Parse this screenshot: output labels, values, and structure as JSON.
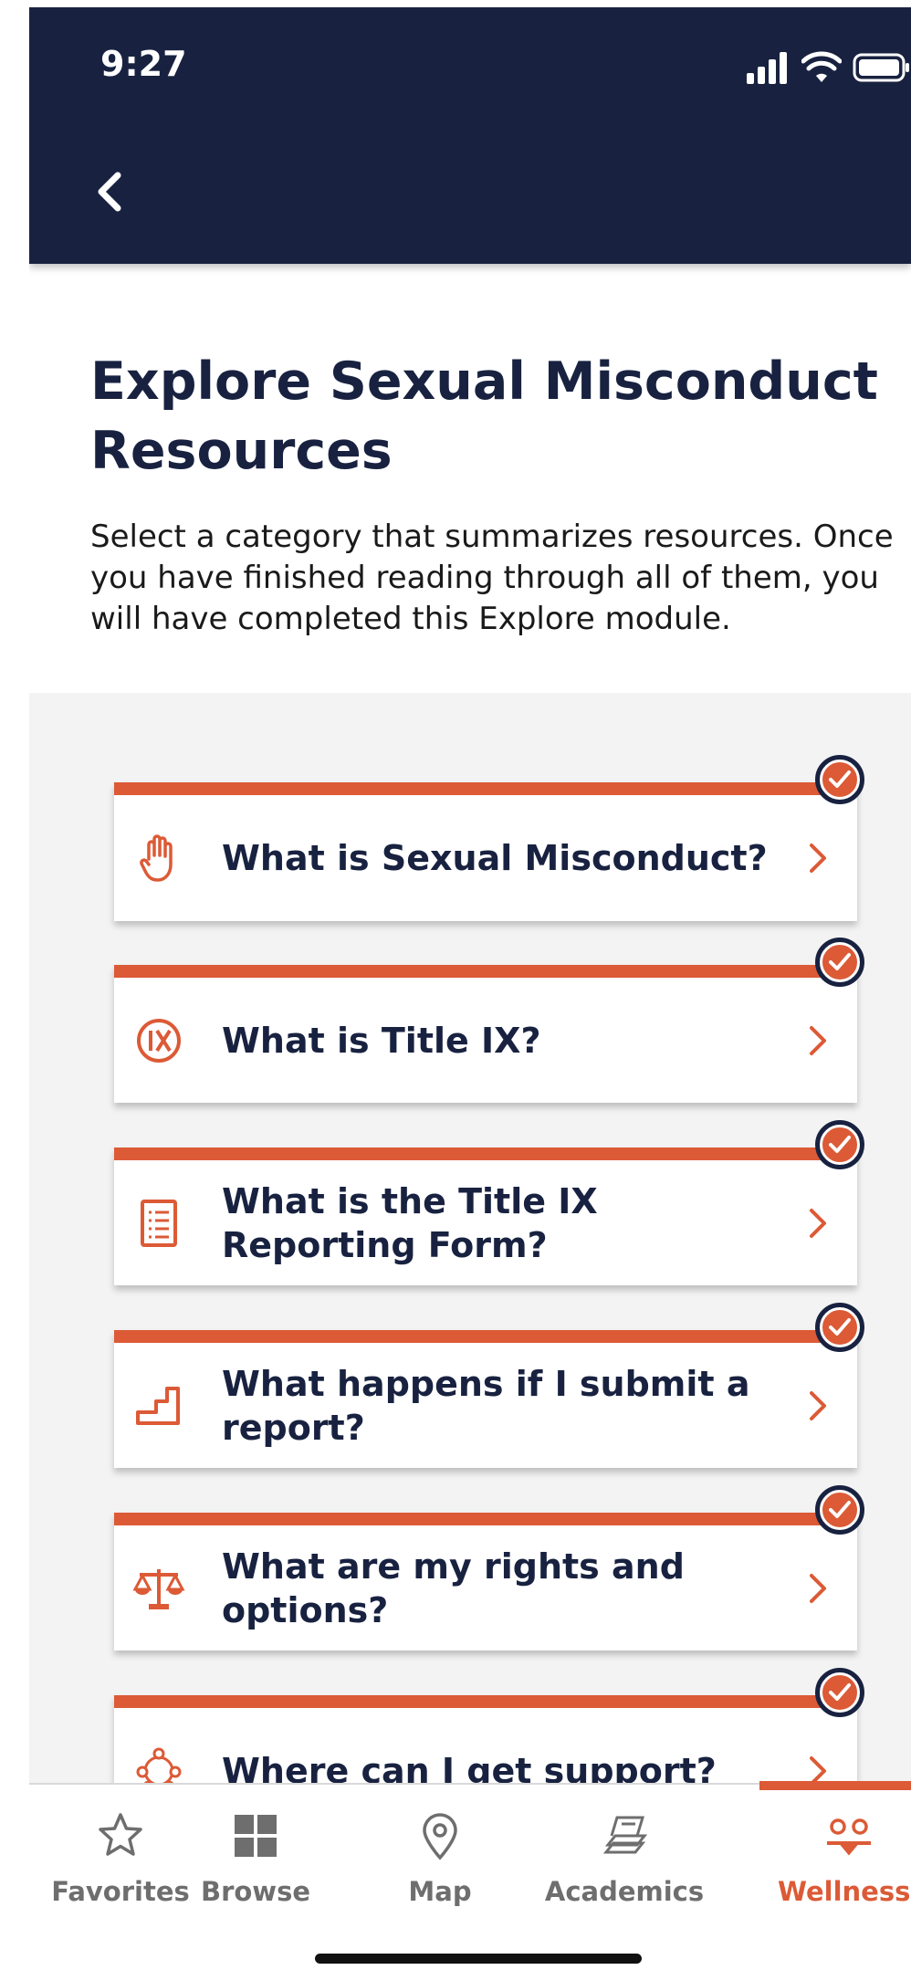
{
  "status": {
    "time": "9:27",
    "signal_icon": "signal-bars-icon",
    "wifi_icon": "wifi-icon",
    "battery_icon": "battery-icon"
  },
  "header": {
    "back_icon": "chevron-left-icon",
    "background_color": "#182240"
  },
  "intro": {
    "title": "Explore Sexual Misconduct Resources",
    "description": "Select a category that summarizes resources. Once you have finished reading through all of them, you will have completed this Explore module."
  },
  "categories": [
    {
      "label": "What is Sexual Misconduct?",
      "icon": "hand-icon",
      "completed": true
    },
    {
      "label": "What is Title IX?",
      "icon": "title-ix-icon",
      "completed": true
    },
    {
      "label": "What is the Title IX Reporting Form?",
      "icon": "document-list-icon",
      "completed": true
    },
    {
      "label": "What happens if I submit a report?",
      "icon": "stairs-icon",
      "completed": true
    },
    {
      "label": "What are my rights and options?",
      "icon": "scales-icon",
      "completed": true
    },
    {
      "label": "Where can I get support?",
      "icon": "people-network-icon",
      "completed": true
    }
  ],
  "tabs": [
    {
      "label": "Favorites",
      "icon": "star-icon",
      "active": false
    },
    {
      "label": "Browse",
      "icon": "grid-icon",
      "active": false
    },
    {
      "label": "Map",
      "icon": "map-pin-icon",
      "active": false
    },
    {
      "label": "Academics",
      "icon": "books-icon",
      "active": false
    },
    {
      "label": "Wellness",
      "icon": "wellness-icon",
      "active": true
    }
  ],
  "colors": {
    "accent": "#dc5a36",
    "navy": "#182240",
    "list_background": "#f3f3f3"
  }
}
